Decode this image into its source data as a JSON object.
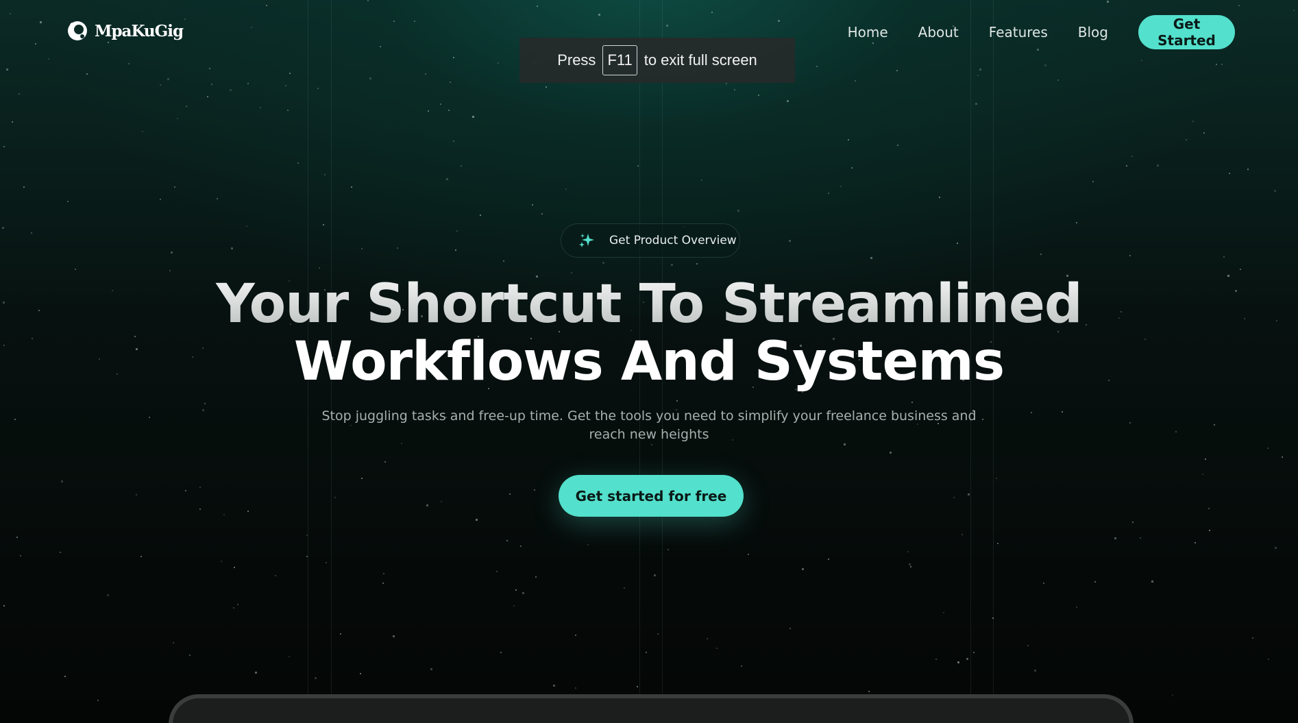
{
  "brand": {
    "name": "MpaKuGig",
    "logo_icon": "mpakugig-logo-icon"
  },
  "nav": {
    "items": [
      {
        "label": "Home"
      },
      {
        "label": "About"
      },
      {
        "label": "Features"
      },
      {
        "label": "Blog"
      }
    ],
    "cta_label": "Get Started"
  },
  "fullscreen_notice": {
    "prefix": "Press",
    "key": "F11",
    "suffix": "to exit full screen"
  },
  "hero": {
    "pill_icon": "sparkle-icon",
    "pill_label": "Get Product Overview",
    "headline_line1": "Your Shortcut To Streamlined",
    "headline_line2": "Workflows And Systems",
    "subtitle_line1": "Stop juggling tasks and free-up time. Get the tools you need to simplify your freelance business and",
    "subtitle_line2": "reach new heights",
    "cta_label": "Get started for free"
  },
  "colors": {
    "accent": "#53e0cc",
    "background": "#050807",
    "glow": "#0e5248"
  }
}
